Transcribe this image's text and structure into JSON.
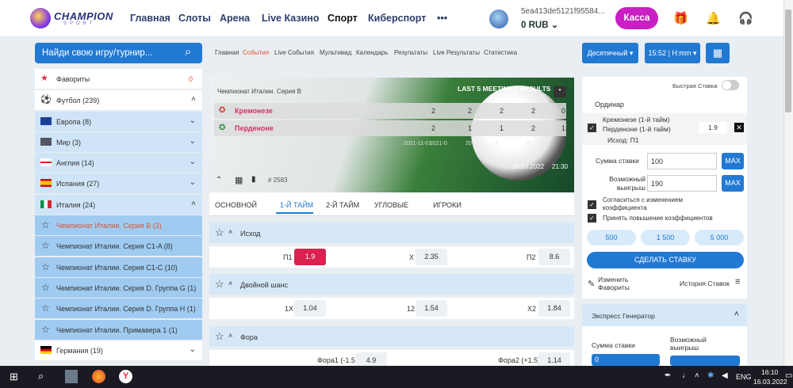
{
  "header": {
    "logo_text": "CHAMPION",
    "logo_sub": "SPORT",
    "nav": [
      "Главная",
      "Слоты",
      "Арена",
      "Live Казино",
      "Спорт",
      "Киберспорт",
      "•••"
    ],
    "account_id": "5ea413de5121f95584...",
    "balance": "0 RUB",
    "kassa": "Касса"
  },
  "search": {
    "placeholder": "Найди свою игру/турнир..."
  },
  "subnav": [
    "Главная",
    "События",
    "Live События",
    "Мультивид",
    "Календарь",
    "Результаты",
    "Live Результаты",
    "Статистика"
  ],
  "controls": {
    "odds_format": "Десятичный",
    "time": "15:52 | H:mm"
  },
  "sidebar": [
    {
      "label": "Фавориты",
      "count": "0"
    },
    {
      "label": "Футбол (239)"
    },
    {
      "label": "Европа (8)"
    },
    {
      "label": "Мир (3)"
    },
    {
      "label": "Англия (14)"
    },
    {
      "label": "Испания (27)"
    },
    {
      "label": "Италия (24)"
    },
    {
      "label": "Чемпионат Италии. Серия B (3)"
    },
    {
      "label": "Чемпионат Италии. Серия C1-A (8)"
    },
    {
      "label": "Чемпионат Италии. Серия C1-C (10)"
    },
    {
      "label": "Чемпионат Италии. Серия D. Группа G (1)"
    },
    {
      "label": "Чемпионат Италии. Серия D. Группа H (1)"
    },
    {
      "label": "Чемпионат Италии. Примавера 1 (1)"
    },
    {
      "label": "Германия (19)"
    }
  ],
  "match": {
    "league": "Чемпионат Италии. Серия B",
    "meetings_title": "LAST 5 MEETINGS RESULTS",
    "team1": "Кремонезе",
    "team2": "Перденоне",
    "t1_scores": [
      "2",
      "2",
      "2",
      "2",
      "0"
    ],
    "t2_scores": [
      "2",
      "1",
      "1",
      "2",
      "1"
    ],
    "dates": [
      "2021-11-01",
      "2021-0",
      "20",
      "2",
      "2"
    ],
    "datetime": "16.03.2022",
    "time": "21:30",
    "id": "# 2583"
  },
  "tabs": [
    "ОСНОВНОЙ",
    "1-Й ТАЙМ",
    "2-Й ТАЙМ",
    "УГЛОВЫЕ",
    "ИГРОКИ"
  ],
  "markets": [
    {
      "title": "Исход",
      "cells": [
        {
          "l": "П1",
          "v": "1.9"
        },
        {
          "l": "X",
          "v": "2.35"
        },
        {
          "l": "П2",
          "v": "8.6"
        }
      ]
    },
    {
      "title": "Двойной шанс",
      "cells": [
        {
          "l": "1X",
          "v": "1.04"
        },
        {
          "l": "12",
          "v": "1.54"
        },
        {
          "l": "X2",
          "v": "1.84"
        }
      ]
    },
    {
      "title": "Фора",
      "cells": [
        {
          "l": "Фора1 (-1.5)",
          "v": "4.9"
        },
        {
          "l": "Фора2 (+1.5)",
          "v": "1.14"
        }
      ]
    }
  ],
  "betslip": {
    "quick_bet": "Быстрая Ставка",
    "ordinar": "Ординар",
    "sel1": "Кремонезе (1-й тайм)",
    "sel2": "Перденоне (1-й тайм)",
    "outcome": "Исход: П1",
    "odd": "1.9",
    "stake_label": "Сумма ставки",
    "stake": "100",
    "win_label": "Возможный выигрыш",
    "win": "190",
    "max": "MAX",
    "agree": "Согласиться с изменением коэффициента",
    "accept": "Принять повышение коэффициентов",
    "quick": [
      "500",
      "1 500",
      "5 000"
    ],
    "place": "СДЕЛАТЬ СТАВКУ",
    "edit_fav": "Изменить Фавориты",
    "history": "История Ставок",
    "express": "Экспресс Генератор",
    "exp_stake": "Сумма ставки",
    "exp_win": "Возможный выигрыш",
    "exp_val": "0"
  },
  "taskbar": {
    "lang": "ENG",
    "time": "16:10",
    "date": "16.03.2022"
  }
}
